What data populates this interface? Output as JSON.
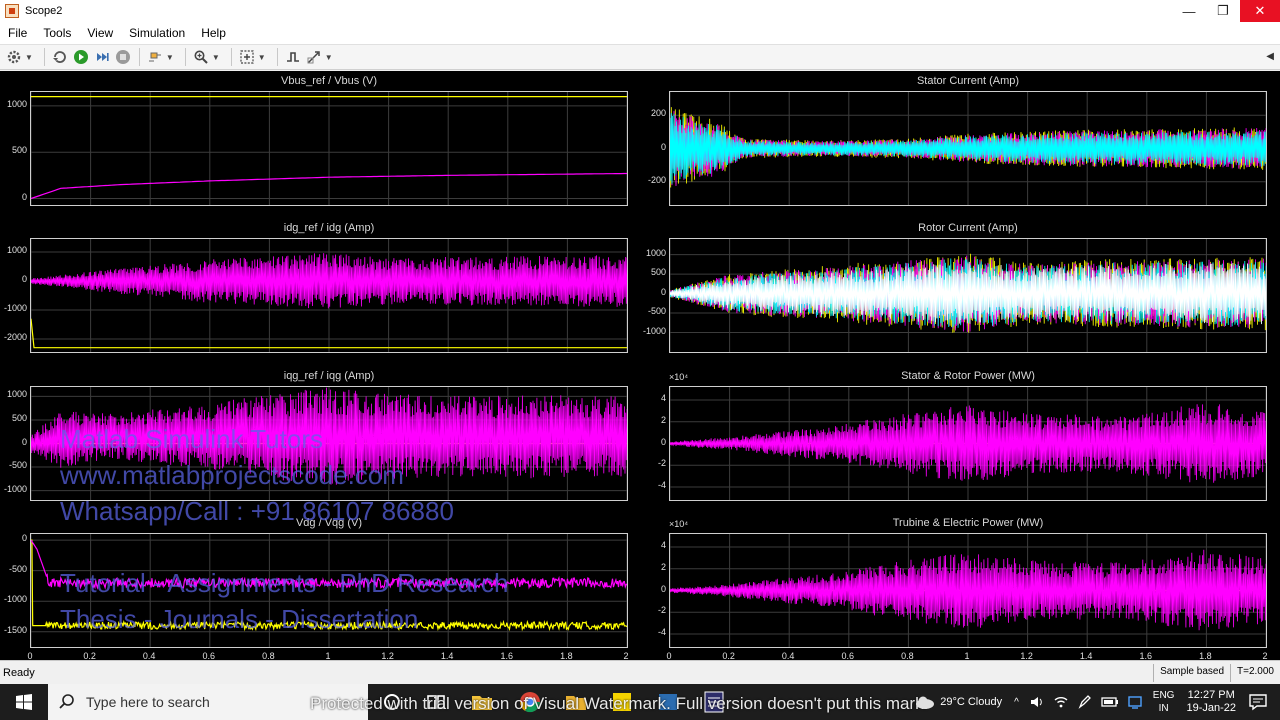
{
  "window": {
    "title": "Scope2",
    "minimize": "—",
    "maximize": "❐",
    "close": "✕"
  },
  "menu": [
    "File",
    "Tools",
    "View",
    "Simulation",
    "Help"
  ],
  "toolbar_icons": [
    "gear-icon",
    "refresh-icon",
    "run-icon",
    "step-forward-icon",
    "stop-icon",
    "highlight-icon",
    "zoom-icon",
    "autoscale-icon",
    "trigger-icon",
    "cursor-icon"
  ],
  "colors": {
    "magenta": "#ff00ff",
    "yellow": "#ffff00",
    "cyan": "#00ffff",
    "grid": "#3c3c3c",
    "frame": "#cfcfcf",
    "background": "#000000"
  },
  "chart_data": [
    {
      "type": "line",
      "title": "Vbus_ref / Vbus (V)",
      "x_ticks": [
        "0",
        "0.2",
        "0.4",
        "0.6",
        "0.8",
        "1",
        "1.2",
        "1.4",
        "1.6",
        "1.8",
        "2"
      ],
      "y_ticks": [
        "1000",
        "500",
        "0"
      ],
      "ylim": [
        -70,
        1150
      ],
      "xlim": [
        0,
        2
      ],
      "grid": true,
      "series": [
        {
          "color": "#ffff00",
          "x": [
            0,
            2
          ],
          "y": [
            1100,
            1100
          ]
        },
        {
          "color": "#ff00ff",
          "x": [
            0,
            0.1,
            0.3,
            0.6,
            1.0,
            1.4,
            2.0
          ],
          "y": [
            0,
            110,
            150,
            190,
            230,
            250,
            270
          ]
        }
      ]
    },
    {
      "type": "line",
      "title": "Stator Current (Amp)",
      "x_ticks": [
        "0",
        "0.2",
        "0.4",
        "0.6",
        "0.8",
        "1",
        "1.2",
        "1.4",
        "1.6",
        "1.8",
        "2"
      ],
      "y_ticks": [
        "200",
        "0",
        "-200"
      ],
      "ylim": [
        -340,
        340
      ],
      "xlim": [
        0,
        2
      ],
      "grid": true,
      "series": [
        {
          "color": "#ffff00",
          "envelope": {
            "x": [
              0,
              0.08,
              0.15,
              0.25,
              0.5,
              0.8,
              1.0,
              1.3,
              1.6,
              2.0
            ],
            "amp": [
              260,
              200,
              180,
              60,
              50,
              60,
              90,
              110,
              120,
              130
            ]
          }
        },
        {
          "color": "#ff00ff",
          "envelope": {
            "x": [
              0,
              0.08,
              0.15,
              0.25,
              0.5,
              0.8,
              1.0,
              1.3,
              1.6,
              2.0
            ],
            "amp": [
              240,
              190,
              170,
              55,
              45,
              55,
              85,
              105,
              115,
              125
            ]
          }
        },
        {
          "color": "#00ffff",
          "envelope": {
            "x": [
              0,
              0.08,
              0.15,
              0.25,
              0.5,
              0.8,
              1.0,
              1.3,
              1.6,
              2.0
            ],
            "amp": [
              220,
              170,
              150,
              50,
              40,
              50,
              75,
              95,
              100,
              110
            ]
          }
        }
      ]
    },
    {
      "type": "line",
      "title": "idg_ref / idg (Amp)",
      "x_ticks": [
        "0",
        "0.2",
        "0.4",
        "0.6",
        "0.8",
        "1",
        "1.2",
        "1.4",
        "1.6",
        "1.8",
        "2"
      ],
      "y_ticks": [
        "1000",
        "0",
        "-1000",
        "-2000"
      ],
      "ylim": [
        -2450,
        1450
      ],
      "xlim": [
        0,
        2
      ],
      "grid": true,
      "series": [
        {
          "color": "#ffff00",
          "x": [
            0,
            0.004,
            0.004,
            2
          ],
          "y": [
            -1300,
            -1300,
            -2300,
            -2300
          ]
        },
        {
          "color": "#ff00ff",
          "envelope": {
            "x": [
              0,
              0.1,
              0.3,
              0.6,
              0.8,
              1.0,
              1.2,
              1.5,
              2.0
            ],
            "amp": [
              100,
              200,
              450,
              750,
              850,
              1000,
              800,
              850,
              900
            ]
          }
        }
      ]
    },
    {
      "type": "line",
      "title": "Rotor Current (Amp)",
      "x_ticks": [
        "0",
        "0.2",
        "0.4",
        "0.6",
        "0.8",
        "1",
        "1.2",
        "1.4",
        "1.6",
        "1.8",
        "2"
      ],
      "y_ticks": [
        "1000",
        "500",
        "0",
        "-500",
        "-1000"
      ],
      "ylim": [
        -1500,
        1400
      ],
      "xlim": [
        0,
        2
      ],
      "grid": true,
      "series": [
        {
          "color": "#ffff00",
          "envelope": {
            "x": [
              0,
              0.2,
              0.5,
              0.8,
              1.0,
              1.2,
              1.5,
              2.0
            ],
            "amp": [
              100,
              500,
              700,
              900,
              1050,
              800,
              900,
              950
            ]
          }
        },
        {
          "color": "#ff00ff",
          "envelope": {
            "x": [
              0,
              0.2,
              0.5,
              0.8,
              1.0,
              1.2,
              1.5,
              2.0
            ],
            "amp": [
              100,
              500,
              650,
              850,
              1000,
              750,
              850,
              900
            ]
          }
        },
        {
          "color": "#00ffff",
          "envelope": {
            "x": [
              0,
              0.2,
              0.5,
              0.8,
              1.0,
              1.2,
              1.5,
              2.0
            ],
            "amp": [
              90,
              450,
              600,
              800,
              950,
              700,
              800,
              850
            ]
          }
        },
        {
          "color": "#ffffff",
          "envelope": {
            "x": [
              0,
              0.2,
              0.5,
              0.8,
              1.0,
              1.2,
              1.5,
              2.0
            ],
            "amp": [
              80,
              400,
              550,
              700,
              850,
              650,
              750,
              800
            ]
          }
        }
      ]
    },
    {
      "type": "line",
      "title": "iqg_ref / iqg (Amp)",
      "x_ticks": [
        "0",
        "0.2",
        "0.4",
        "0.6",
        "0.8",
        "1",
        "1.2",
        "1.4",
        "1.6",
        "1.8",
        "2"
      ],
      "y_ticks": [
        "1000",
        "500",
        "0",
        "-500",
        "-1000"
      ],
      "ylim": [
        -1200,
        1200
      ],
      "xlim": [
        0,
        2
      ],
      "grid": true,
      "series": [
        {
          "color": "#ffff00",
          "x": [
            0,
            2
          ],
          "y": [
            0,
            0
          ]
        },
        {
          "color": "#ff00ff",
          "envelope": {
            "x": [
              0,
              0.1,
              0.3,
              0.6,
              0.8,
              1.0,
              1.2,
              1.5,
              1.7,
              2.0
            ],
            "amp": [
              200,
              600,
              500,
              700,
              900,
              1050,
              900,
              850,
              900,
              850
            ]
          },
          "offset": 150
        }
      ]
    },
    {
      "type": "line",
      "title": "Stator & Rotor Power (MW)",
      "y_exponent": "×10⁴",
      "x_ticks": [
        "0",
        "0.2",
        "0.4",
        "0.6",
        "0.8",
        "1",
        "1.2",
        "1.4",
        "1.6",
        "1.8",
        "2"
      ],
      "y_ticks": [
        "4",
        "2",
        "0",
        "-2",
        "-4"
      ],
      "ylim": [
        -5.2,
        5.2
      ],
      "xlim": [
        0,
        2
      ],
      "grid": true,
      "series": [
        {
          "color": "#ffff00",
          "x": [
            0,
            2
          ],
          "y": [
            0,
            0
          ]
        },
        {
          "color": "#ff00ff",
          "envelope": {
            "x": [
              0,
              0.2,
              0.5,
              0.8,
              1.0,
              1.2,
              1.5,
              1.8,
              2.0
            ],
            "amp": [
              0.2,
              0.6,
              1.5,
              2.8,
              3.6,
              2.8,
              2.6,
              3.8,
              3.0
            ]
          }
        }
      ]
    },
    {
      "type": "line",
      "title": "Vdg / Vqg (V)",
      "x_ticks": [
        "0",
        "0.2",
        "0.4",
        "0.6",
        "0.8",
        "1",
        "1.2",
        "1.4",
        "1.6",
        "1.8",
        "2"
      ],
      "y_ticks": [
        "0",
        "-500",
        "-1000",
        "-1500"
      ],
      "ylim": [
        -1750,
        100
      ],
      "xlim": [
        0,
        2
      ],
      "grid": true,
      "series": [
        {
          "color": "#ffff00",
          "x": [
            0,
            0.004,
            0.004,
            2
          ],
          "y": [
            0,
            0,
            -1400,
            -1400
          ],
          "noise": 60
        },
        {
          "color": "#ff00ff",
          "x": [
            0,
            0.02,
            0.06,
            0.08,
            2
          ],
          "y": [
            0,
            -150,
            -700,
            -700,
            -700
          ],
          "noise": 80
        }
      ]
    },
    {
      "type": "line",
      "title": "Trubine & Electric Power (MW)",
      "y_exponent": "×10⁴",
      "x_ticks": [
        "0",
        "0.2",
        "0.4",
        "0.6",
        "0.8",
        "1",
        "1.2",
        "1.4",
        "1.6",
        "1.8",
        "2"
      ],
      "y_ticks": [
        "4",
        "2",
        "0",
        "-2",
        "-4"
      ],
      "ylim": [
        -5.2,
        5.2
      ],
      "xlim": [
        0,
        2
      ],
      "grid": true,
      "series": [
        {
          "color": "#ffff00",
          "x": [
            0,
            2
          ],
          "y": [
            0,
            0
          ]
        },
        {
          "color": "#ff00ff",
          "envelope": {
            "x": [
              0,
              0.2,
              0.5,
              0.8,
              1.0,
              1.2,
              1.5,
              1.8,
              2.0
            ],
            "amp": [
              0.2,
              0.6,
              1.5,
              2.8,
              3.6,
              2.8,
              2.6,
              3.8,
              3.0
            ]
          }
        }
      ]
    }
  ],
  "watermark": {
    "lines": [
      "Matlab Simulink Tutors",
      "www.matlabprojectscode.com",
      "Whatsapp/Call : +91 86107 86880",
      "Tutorial - Assignments - PhD Research",
      "Thesis - Journals - Dissertation"
    ]
  },
  "status": {
    "left": "Ready",
    "sample": "Sample based",
    "time": "T=2.000"
  },
  "taskbar": {
    "search_placeholder": "Type here to search",
    "banner": "Protected with trial version of Visual Watermark. Full version doesn't put this mark.",
    "weather": "29°C  Cloudy",
    "lang_top": "ENG",
    "lang_bottom": "IN",
    "time": "12:27 PM",
    "date": "19-Jan-22"
  }
}
